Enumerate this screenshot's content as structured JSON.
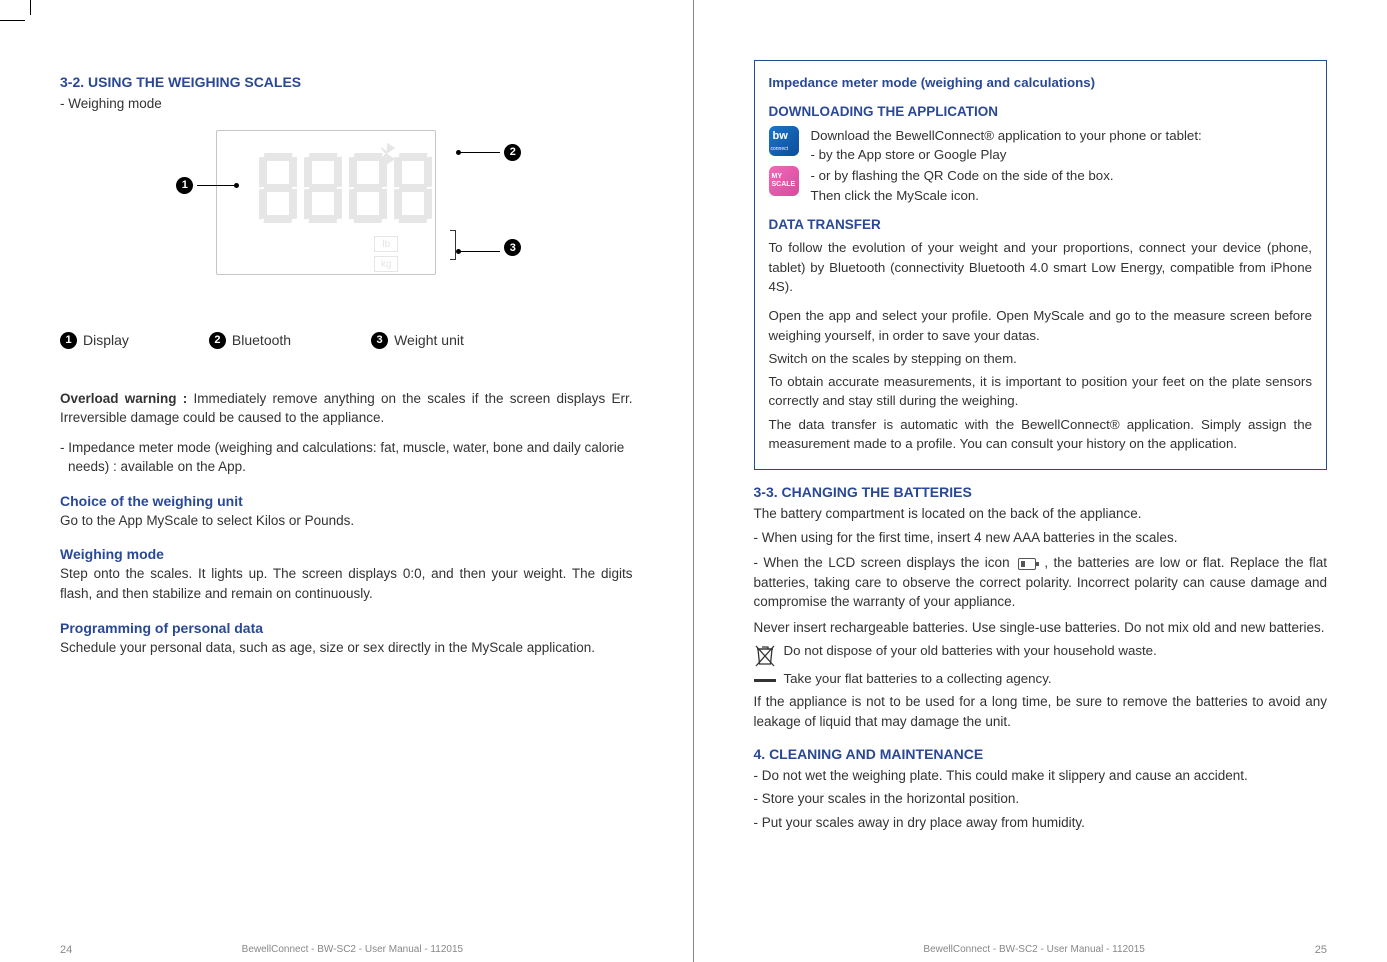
{
  "left": {
    "crop_visible": true,
    "h_3_2": "3-2. USING THE WEIGHING SCALES",
    "weighing_mode_label": "- Weighing mode",
    "legend": {
      "item1": "Display",
      "item2": "Bluetooth",
      "item3": "Weight unit",
      "n1": "1",
      "n2": "2",
      "n3": "3"
    },
    "diagram": {
      "unit_lb": "lb",
      "unit_kg": "kg"
    },
    "overload_label": "Overload warning : ",
    "overload_text": "Immediately remove anything on the scales if the screen displays Err. Irreversible damage could be caused to the appliance.",
    "impedance_note": "- Impedance meter mode (weighing and calculations: fat, muscle, water, bone and daily calorie needs) : available on the App.",
    "h_choice": "Choice of the weighing unit",
    "choice_text": "Go to the App MyScale to select Kilos or Pounds.",
    "h_wmode": "Weighing mode",
    "wmode_text": "Step onto the scales. It lights up. The screen displays 0:0, and then your weight. The digits flash, and then stabilize and remain on continuously.",
    "h_prog": "Programming of personal data",
    "prog_text": "Schedule your personal data, such as age, size or sex directly in the MyScale application.",
    "footer_text": "BewellConnect - BW-SC2 - User Manual - 112015",
    "page_num": "24"
  },
  "right": {
    "box": {
      "title": "Impedance meter mode (weighing and calculations)",
      "h_download": "DOWNLOADING THE APPLICATION",
      "dl_line1": "Download the BewellConnect® application to your phone or tablet:",
      "dl_line2": " - by the App store or Google Play",
      "dl_line3": " - or by flashing the QR Code on the side of the box.",
      "dl_line4": "Then click the MyScale icon.",
      "h_transfer": "DATA TRANSFER",
      "t1": "To follow the evolution of your weight and your proportions, connect your device (phone, tablet) by Bluetooth (connectivity Bluetooth 4.0 smart Low Energy, compatible from iPhone 4S).",
      "t2": "Open the app and select your profile. Open MyScale and go to the measure screen before weighing yourself, in order to save your datas.",
      "t3": "Switch on the scales by stepping on them.",
      "t4": "To obtain accurate measurements, it is important to position your feet on the plate sensors correctly and stay still during the weighing.",
      "t5": "The data transfer is automatic with the BewellConnect® application. Simply assign the measurement made to a profile. You can consult your history on the application."
    },
    "h_3_3": "3-3. CHANGING THE BATTERIES",
    "b1": "The battery compartment is located on the back of the appliance.",
    "b2": "- When using for the first time, insert 4 new AAA batteries in the scales.",
    "b3a": "- When the LCD screen displays the icon ",
    "b3b": " , the batteries are low or flat. Replace the flat batteries, taking care to observe the correct polarity. Incorrect polarity can cause damage and compromise the warranty of your appliance.",
    "b4": "Never insert rechargeable batteries. Use single-use batteries. Do not mix old and new batteries.",
    "weee1": "Do not dispose of your old batteries with your household waste.",
    "weee2": "Take your flat batteries to a collecting agency.",
    "b5": "If the appliance is not to be used for a long time, be sure to remove the batteries to avoid any leakage of liquid that may damage the unit.",
    "h_4": "4. CLEANING AND MAINTENANCE",
    "c1": "- Do not wet the weighing plate. This could make it slippery and cause an accident.",
    "c2": "- Store your scales in the horizontal position.",
    "c3": "- Put your scales away in dry place away from humidity.",
    "footer_text": "BewellConnect - BW-SC2 - User Manual - 112015",
    "page_num": "25"
  }
}
